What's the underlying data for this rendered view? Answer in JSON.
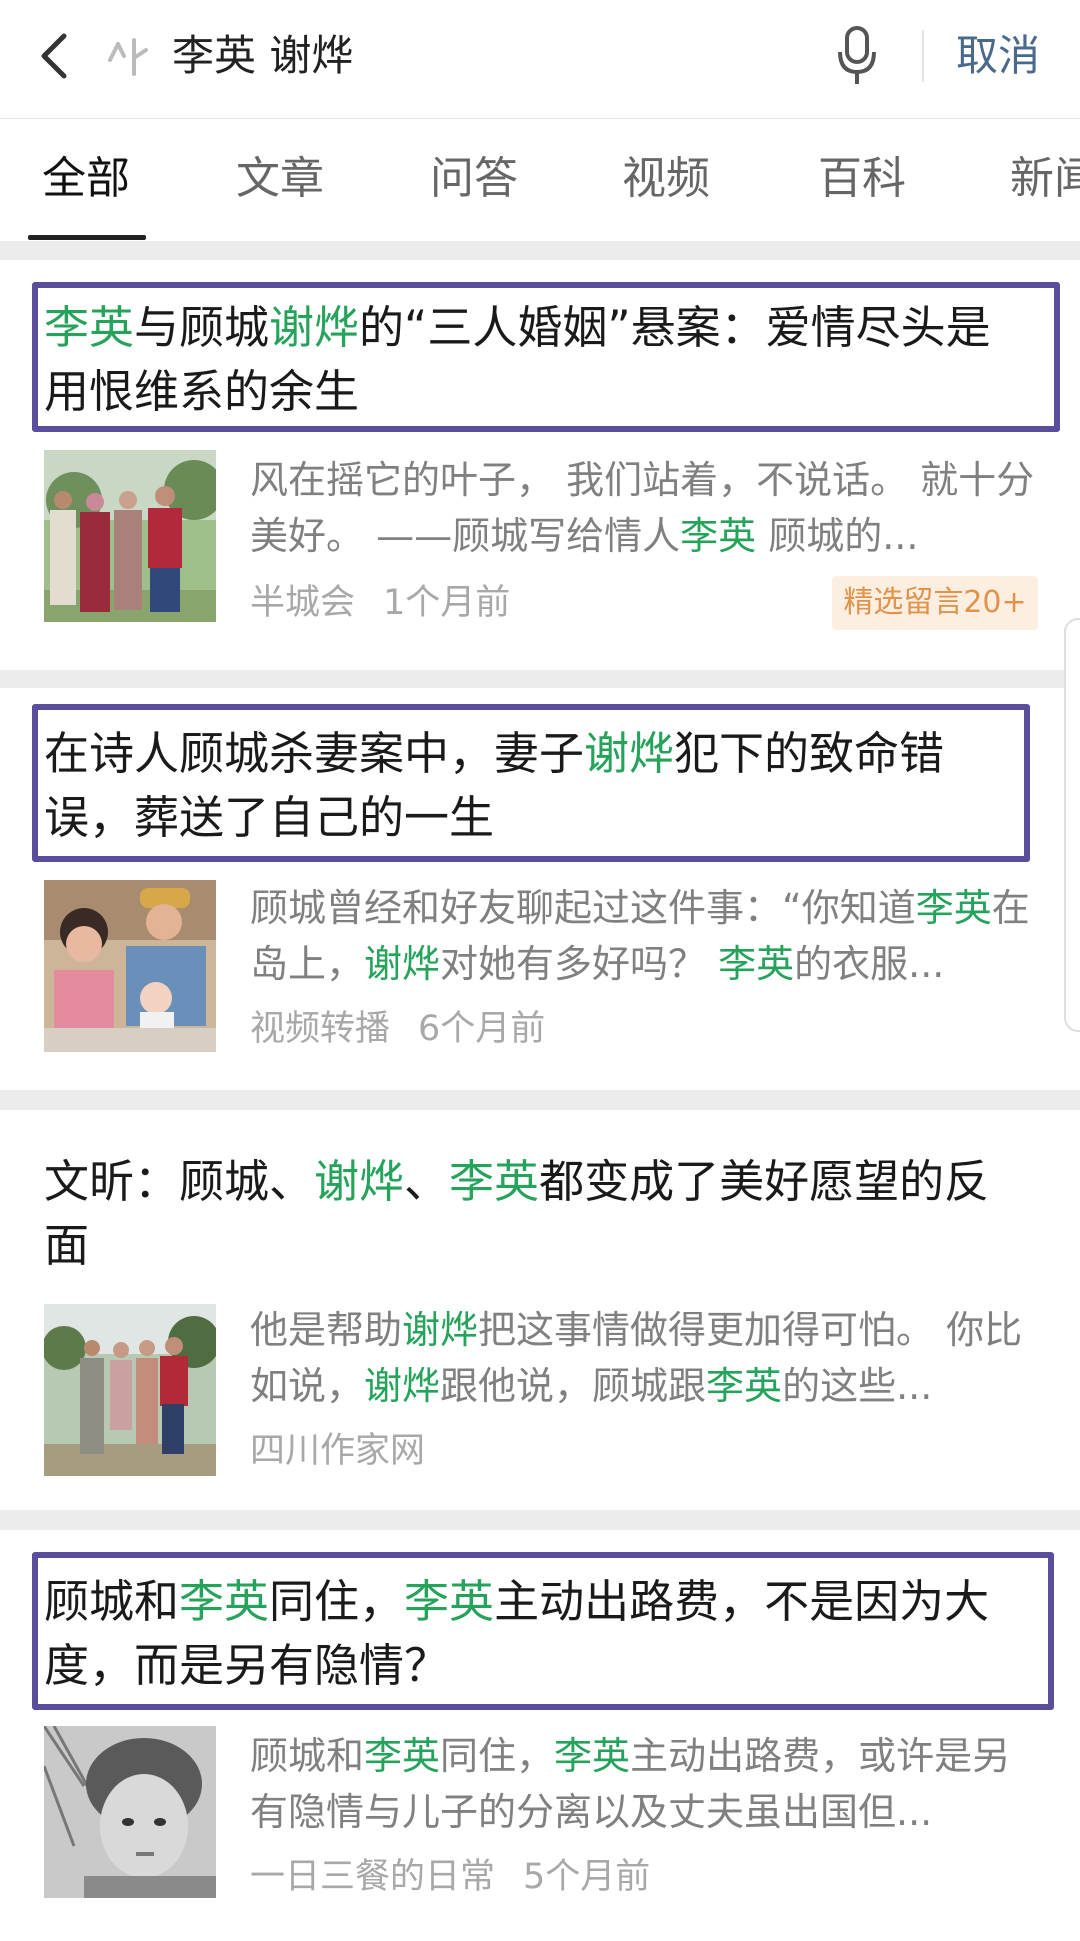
{
  "search": {
    "query": "李英 谢烨",
    "cancel_label": "取消"
  },
  "tabs": [
    "全部",
    "文章",
    "问答",
    "视频",
    "百科",
    "新闻"
  ],
  "colors": {
    "highlight": "#25a35a",
    "box_border": "#5a4e9c",
    "badge_bg": "#fcefe2",
    "badge_text": "#e1934a"
  },
  "results": [
    {
      "title": [
        {
          "t": "李英",
          "hl": true
        },
        {
          "t": "与顾城",
          "hl": false
        },
        {
          "t": "谢烨",
          "hl": true
        },
        {
          "t": "的“三人婚姻”悬案：爱情尽头是用恨维系的余生",
          "hl": false
        }
      ],
      "snippet": [
        {
          "t": "风在摇它的叶子， 我们站着，不说话。 就十分美好。 ——顾城写给情人",
          "hl": false
        },
        {
          "t": "李英",
          "hl": true
        },
        {
          "t": " 顾城的...",
          "hl": false
        }
      ],
      "source": "半城会",
      "time": "1个月前",
      "badge": "精选留言20+"
    },
    {
      "title": [
        {
          "t": "在诗人顾城杀妻案中，妻子",
          "hl": false
        },
        {
          "t": "谢烨",
          "hl": true
        },
        {
          "t": "犯下的致命错误，葬送了自己的一生",
          "hl": false
        }
      ],
      "snippet": [
        {
          "t": "顾城曾经和好友聊起过这件事：“你知道",
          "hl": false
        },
        {
          "t": "李英",
          "hl": true
        },
        {
          "t": "在岛上，",
          "hl": false
        },
        {
          "t": "谢烨",
          "hl": true
        },
        {
          "t": "对她有多好吗？ ",
          "hl": false
        },
        {
          "t": "李英",
          "hl": true
        },
        {
          "t": "的衣服...",
          "hl": false
        }
      ],
      "source": "视频转播",
      "time": "6个月前"
    },
    {
      "title": [
        {
          "t": "文昕：顾城、",
          "hl": false
        },
        {
          "t": "谢烨",
          "hl": true
        },
        {
          "t": "、",
          "hl": false
        },
        {
          "t": "李英",
          "hl": true
        },
        {
          "t": "都变成了美好愿望的反面",
          "hl": false
        }
      ],
      "snippet": [
        {
          "t": "他是帮助",
          "hl": false
        },
        {
          "t": "谢烨",
          "hl": true
        },
        {
          "t": "把这事情做得更加得可怕。 你比如说，",
          "hl": false
        },
        {
          "t": "谢烨",
          "hl": true
        },
        {
          "t": "跟他说，顾城跟",
          "hl": false
        },
        {
          "t": "李英",
          "hl": true
        },
        {
          "t": "的这些...",
          "hl": false
        }
      ],
      "source": "四川作家网",
      "time": ""
    },
    {
      "title": [
        {
          "t": "顾城和",
          "hl": false
        },
        {
          "t": "李英",
          "hl": true
        },
        {
          "t": "同住，",
          "hl": false
        },
        {
          "t": "李英",
          "hl": true
        },
        {
          "t": "主动出路费，不是因为大度，而是另有隐情？",
          "hl": false
        }
      ],
      "snippet": [
        {
          "t": "顾城和",
          "hl": false
        },
        {
          "t": "李英",
          "hl": true
        },
        {
          "t": "同住，",
          "hl": false
        },
        {
          "t": "李英",
          "hl": true
        },
        {
          "t": "主动出路费，或许是另有隐情与儿子的分离以及丈夫虽出国但...",
          "hl": false
        }
      ],
      "source": "一日三餐的日常",
      "time": "5个月前"
    }
  ]
}
